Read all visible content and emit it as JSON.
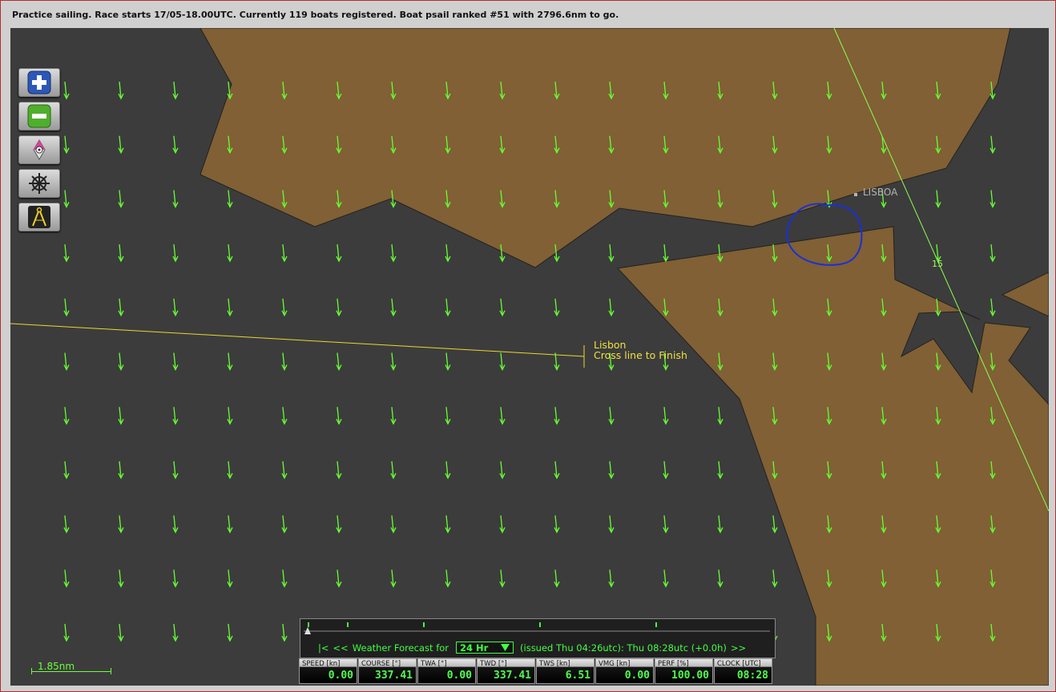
{
  "status": {
    "text": "Practice sailing. Race starts 17/05-18.00UTC. Currently 119 boats registered. Boat psail ranked #51 with 2796.6nm to go."
  },
  "map": {
    "water_color": "#3c3c3c",
    "land_color": "#806034",
    "wind_arrow_color": "#66ff33",
    "finish_label": "Lisbon",
    "finish_sub_label": "Cross line to Finish",
    "city_label": "LISBOA",
    "layline_label": "15",
    "scale_label": "1.85nm"
  },
  "toolbar": [
    {
      "name": "zoom-in-button",
      "icon": "plus-icon"
    },
    {
      "name": "zoom-out-button",
      "icon": "minus-icon"
    },
    {
      "name": "center-boat-button",
      "icon": "compass-icon"
    },
    {
      "name": "helm-button",
      "icon": "ship-wheel-icon"
    },
    {
      "name": "measure-button",
      "icon": "divider-compass-icon"
    }
  ],
  "forecast": {
    "first": "|<",
    "prev": "<<",
    "label": "Weather Forecast for",
    "selected": "24 Hr",
    "issued": "(issued Thu 04:26utc): Thu 08:28utc  (+0.0h)",
    "next": ">>"
  },
  "instruments": [
    {
      "label": "SPEED [kn]",
      "value": "0.00"
    },
    {
      "label": "COURSE [°]",
      "value": "337.41"
    },
    {
      "label": "TWA [°]",
      "value": "0.00"
    },
    {
      "label": "TWD [°]",
      "value": "337.41"
    },
    {
      "label": "TWS [kn]",
      "value": "6.51"
    },
    {
      "label": "VMG [kn]",
      "value": "0.00"
    },
    {
      "label": "PERF [%]",
      "value": "100.00"
    },
    {
      "label": "CLOCK [UTC]",
      "value": "08:28"
    }
  ]
}
